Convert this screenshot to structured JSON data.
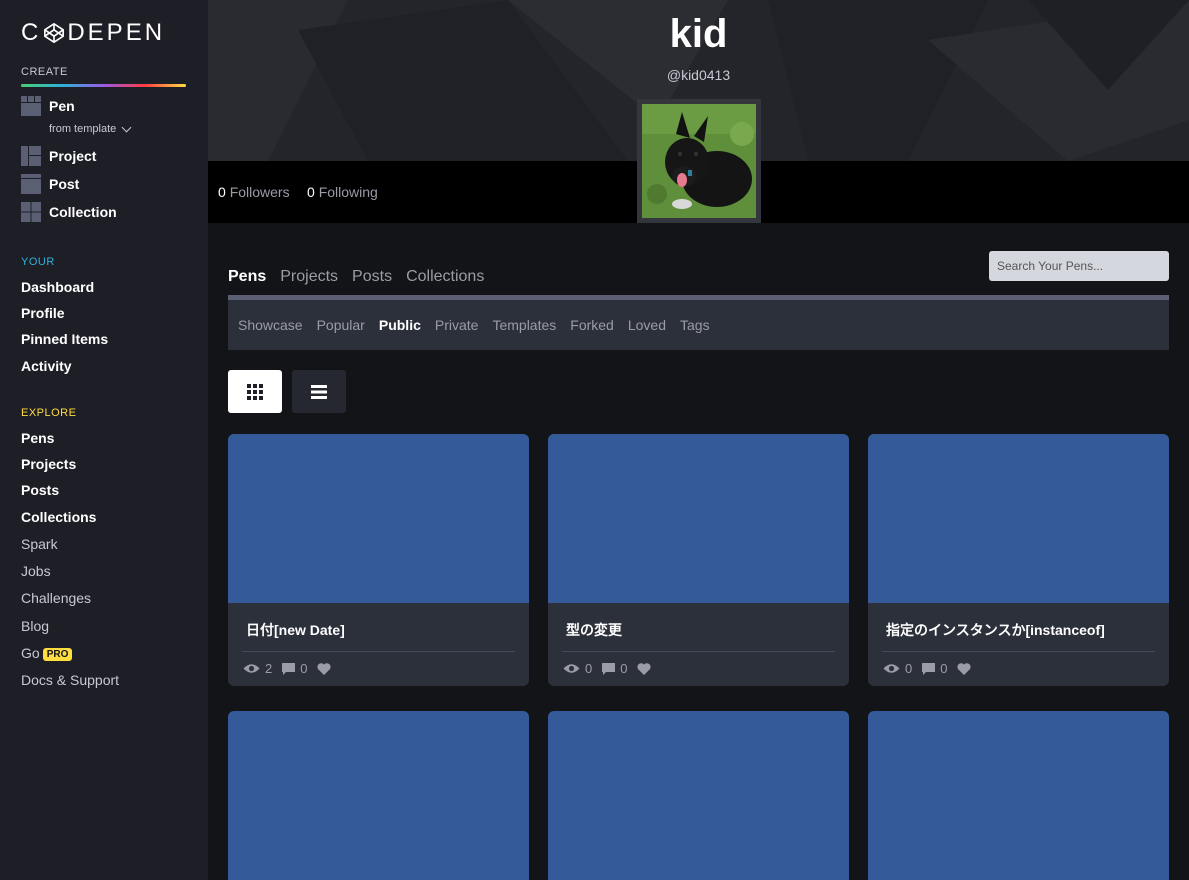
{
  "brand": {
    "logo_left": "C",
    "logo_right": "DEPEN"
  },
  "sidebar": {
    "create_label": "CREATE",
    "create_items": [
      "Pen",
      "Project",
      "Post",
      "Collection"
    ],
    "from_template": "from template",
    "your_label": "YOUR",
    "your_items": [
      "Dashboard",
      "Profile",
      "Pinned Items",
      "Activity"
    ],
    "explore_label": "EXPLORE",
    "explore_bold_items": [
      "Pens",
      "Projects",
      "Posts",
      "Collections"
    ],
    "explore_items": [
      "Spark",
      "Jobs",
      "Challenges",
      "Blog"
    ],
    "go_label": "Go",
    "pro_badge": "PRO",
    "docs_label": "Docs & Support"
  },
  "profile": {
    "name": "kid",
    "handle": "@kid0413",
    "followers_count": "0",
    "followers_label": "Followers",
    "following_count": "0",
    "following_label": "Following"
  },
  "tabs": [
    "Pens",
    "Projects",
    "Posts",
    "Collections"
  ],
  "active_tab": "Pens",
  "search": {
    "placeholder": "Search Your Pens..."
  },
  "subtabs": [
    "Showcase",
    "Popular",
    "Public",
    "Private",
    "Templates",
    "Forked",
    "Loved",
    "Tags"
  ],
  "active_subtab": "Public",
  "colors": {
    "preview": "#345a9a",
    "accent_your": "#2fb1d8",
    "accent_explore": "#ffdd40"
  },
  "pens": [
    {
      "title": "日付[new Date]",
      "views": "2",
      "comments": "0"
    },
    {
      "title": "型の変更",
      "views": "0",
      "comments": "0"
    },
    {
      "title": "指定のインスタンスか[instanceof]",
      "views": "0",
      "comments": "0"
    }
  ]
}
